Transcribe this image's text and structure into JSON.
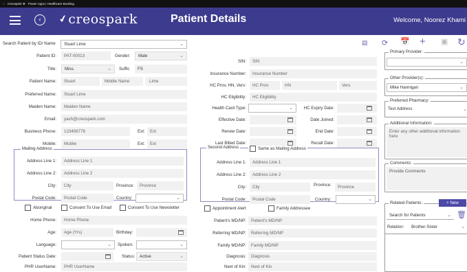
{
  "sysbar": {
    "app": "Creospark ⚙",
    "crumb": "Power Apps | Healthcare Booking"
  },
  "header": {
    "logo": "creospark",
    "title": "Patient Details",
    "welcome": "Welcome, Noorez Khami"
  },
  "search": {
    "label": "Search Patient by ID/ Name",
    "value": "Stuart Lime"
  },
  "left": {
    "patient_id": {
      "label": "Patient ID:",
      "value": "PAT-00013"
    },
    "gender": {
      "label": "Gender:",
      "value": "Male"
    },
    "title": {
      "label": "Title:",
      "value": "Miss."
    },
    "suffix": {
      "label": "Suffic",
      "value": "FS"
    },
    "name": {
      "label": "Patient Name:",
      "first": "Stuart",
      "middle": "Middle Name",
      "last": "Lime"
    },
    "preferred": {
      "label": "Preferred Name:",
      "value": "Stuart Lime"
    },
    "maiden": {
      "label": "Maiden Name:",
      "value": "Maiden Name"
    },
    "email": {
      "label": "Email:",
      "value": "yash@creospark.com"
    },
    "bphone": {
      "label": "Business Phone:",
      "value": "123456776",
      "ext_label": "Ext:",
      "ext": "Ext"
    },
    "mobile": {
      "label": "Mobile:",
      "value": "Mobile",
      "ext_label": "Ext:",
      "ext": "Ext"
    },
    "mailing": {
      "legend": "Mailing Address",
      "l1_label": "Address Line 1:",
      "l1": "Address Line 1",
      "l2_label": "Address Line 2:",
      "l2": "Address Line 2",
      "city_label": "City:",
      "city": "City",
      "prov_label": "Province:",
      "prov": "Province",
      "postal_label": "Postal Code:",
      "postal": "Postal Code",
      "country_label": "Country:",
      "country": ""
    },
    "checks": {
      "aboriginal": "Aboriginal",
      "consent_email": "Consent To Use Email",
      "consent_news": "Consent To Use Newsletter"
    },
    "home_phone": {
      "label": "Home Phone:",
      "value": "Home Phone"
    },
    "age": {
      "label": "Age:",
      "value": "Age (Yrs)"
    },
    "birthday": {
      "label": "Birthday:",
      "value": ""
    },
    "language": {
      "label": "Language:",
      "value": ""
    },
    "spoken": {
      "label": "Spoken:",
      "value": ""
    },
    "status_date": {
      "label": "Patient Status Date:",
      "value": ""
    },
    "status": {
      "label": "Status:",
      "value": "Active"
    },
    "phr": {
      "label": "PHR UserName:",
      "value": "PHR UserName"
    }
  },
  "mid": {
    "sin": {
      "label": "SIN:",
      "value": "SIN"
    },
    "ins": {
      "label": "Insurance Number:",
      "value": "Insurance Number"
    },
    "hc": {
      "label": "HC Prov, HN, Vers:",
      "prov": "HC Prov",
      "hn": "HN",
      "vers": "Vers"
    },
    "elig": {
      "label": "HC Eligibility:",
      "value": "HC Eligibility"
    },
    "card_type": {
      "label": "Health Card Type:",
      "value": ""
    },
    "hc_expiry": {
      "label": "HC Expiry Date:"
    },
    "eff": {
      "label": "Effective Date:"
    },
    "joined": {
      "label": "Date Joined:"
    },
    "renew": {
      "label": "Renew Date:"
    },
    "end": {
      "label": "End Date:"
    },
    "billed": {
      "label": "Last Billed Date:"
    },
    "recall": {
      "label": "Recall Date:"
    },
    "second": {
      "legend": "Second Address",
      "same": "Same as Mailing Address",
      "l1_label": "Address Line 1:",
      "l1": "Address Line 1",
      "l2_label": "Address Line 2:",
      "l2": "Address Line 2",
      "city_label": "City:",
      "city": "City",
      "prov_label": "Province:",
      "prov": "Province",
      "postal_label": "Postal Code:",
      "postal": "Postal Code",
      "country_label": "Country:",
      "country": ""
    },
    "checks": {
      "alert": "Appointment Alert",
      "family": "Family Addressee"
    },
    "md": {
      "label": "Patient's MD/NP:",
      "value": "Patient's MD/NP"
    },
    "ref": {
      "label": "Referring MD/NP:",
      "value": "Referring MD/NP"
    },
    "fam": {
      "label": "Family MD/NP:",
      "value": "Family MD/NP"
    },
    "diag": {
      "label": "Diagnosis:",
      "value": "Diagnosis"
    },
    "kin": {
      "label": "Next of Kin:",
      "value": "Next of Kin"
    }
  },
  "right": {
    "primary": {
      "legend": "Primary Provider:",
      "value": ""
    },
    "other": {
      "legend": "Other Provider(s):",
      "value": "Mike Hannigan"
    },
    "pharmacy": {
      "legend": "Preferred Pharmacy:",
      "value": "Test Address"
    },
    "additional": {
      "legend": "Additional Information:",
      "placeholder": "Enter any other additional information here"
    },
    "comments": {
      "legend": "Comments:",
      "value": "Provide Comments"
    },
    "related": {
      "legend": "Related Patients:",
      "new": "+ New",
      "search": "Search for Patients",
      "relation_label": "Relation:",
      "relation": "Brother-Sister"
    }
  },
  "colors": {
    "header": "#3d3b8e",
    "accent": "#6a68b3"
  }
}
